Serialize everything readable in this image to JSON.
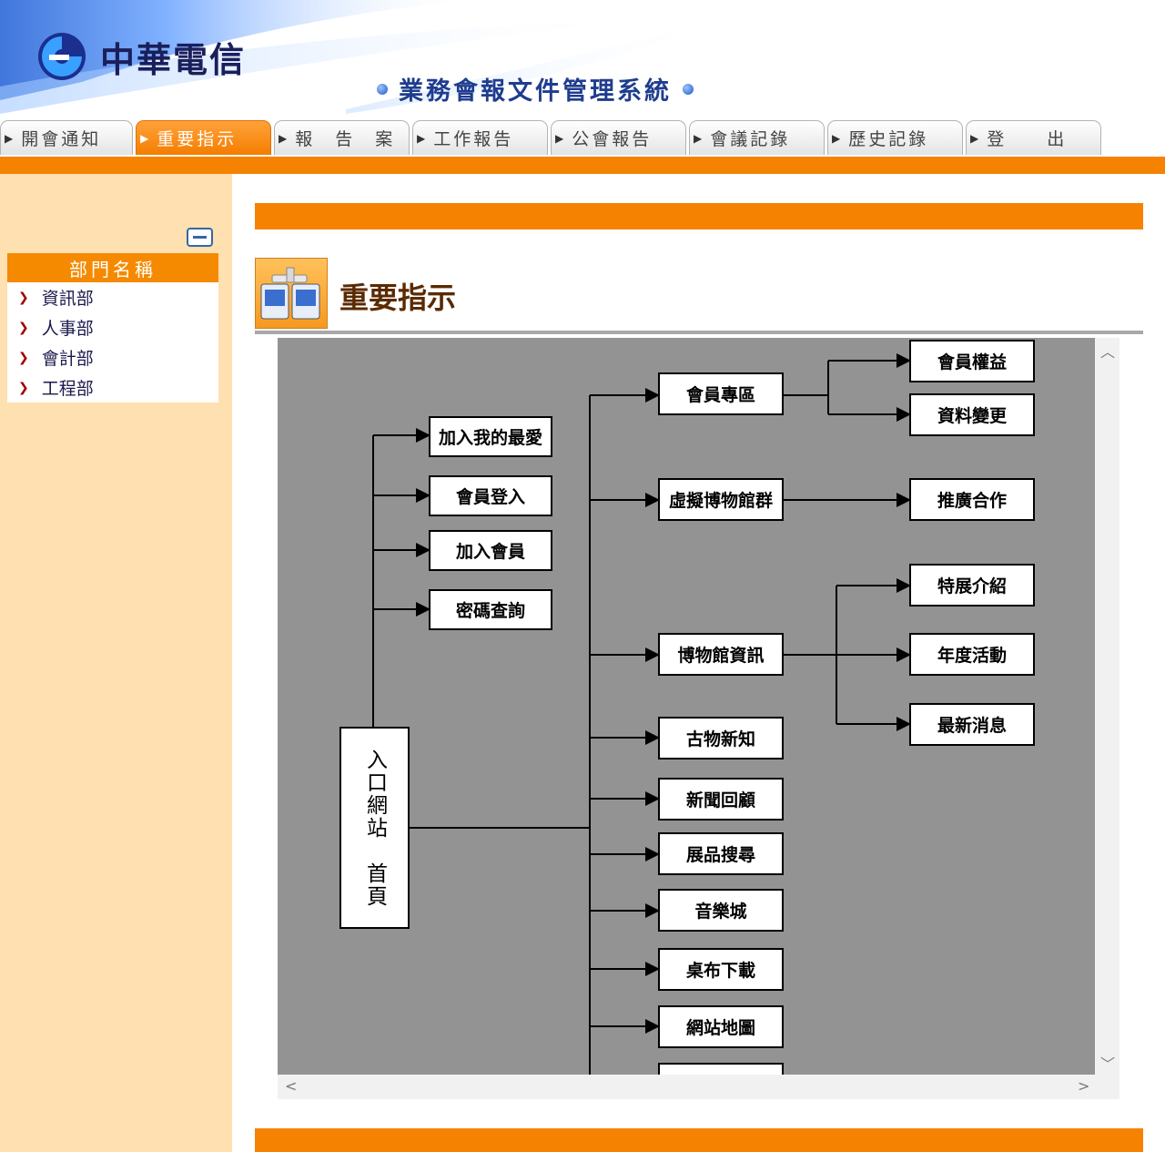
{
  "brand": {
    "name": "中華電信",
    "logo_icon": "cht-logo-icon"
  },
  "system_title": "業務會報文件管理系統",
  "nav": {
    "tabs": [
      {
        "label": "開會通知",
        "active": false
      },
      {
        "label": "重要指示",
        "active": true
      },
      {
        "label": "報　告　案",
        "active": false
      },
      {
        "label": "工作報告",
        "active": false
      },
      {
        "label": "公會報告",
        "active": false
      },
      {
        "label": "會議記錄",
        "active": false
      },
      {
        "label": "歷史記錄",
        "active": false
      },
      {
        "label": "登　　出",
        "active": false
      }
    ]
  },
  "sidebar": {
    "collapse_icon": "collapse-minus-icon",
    "heading": "部門名稱",
    "items": [
      {
        "label": "資訊部"
      },
      {
        "label": "人事部"
      },
      {
        "label": "會計部"
      },
      {
        "label": "工程部"
      }
    ]
  },
  "page": {
    "title": "重要指示",
    "icon": "network-computers-icon"
  },
  "sitemap": {
    "root": "入口網站　首頁",
    "left_nodes": [
      "加入我的最愛",
      "會員登入",
      "加入會員",
      "密碼查詢"
    ],
    "mid_nodes": [
      "會員專區",
      "虛擬博物館群",
      "博物館資訊",
      "古物新知",
      "新聞回顧",
      "展品搜尋",
      "音樂城",
      "桌布下載",
      "網站地圖"
    ],
    "right_nodes": [
      "會員權益",
      "資料變更",
      "推廣合作",
      "特展介紹",
      "年度活動",
      "最新消息"
    ]
  },
  "colors": {
    "accent": "#f58200",
    "sidebar_bg": "#ffe0b0",
    "diagram_bg": "#939393",
    "title_text": "#5a2a00"
  }
}
